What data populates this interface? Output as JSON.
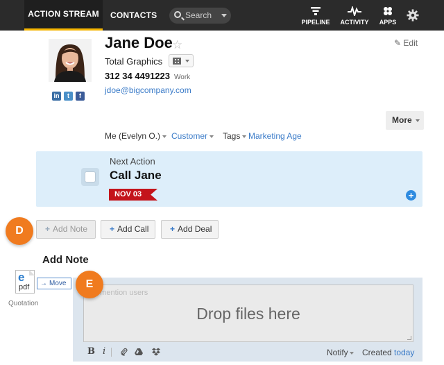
{
  "nav": {
    "active_tab": "ACTION STREAM",
    "contacts_tab": "CONTACTS",
    "search_placeholder": "Search",
    "pipeline": "PIPELINE",
    "activity": "ACTIVITY",
    "apps": "APPS"
  },
  "contact": {
    "name": "Jane Doe",
    "company": "Total Graphics",
    "phone": "312 34 4491223",
    "phone_type": "Work",
    "email": "jdoe@bigcompany.com",
    "edit_label": "Edit",
    "more_label": "More",
    "socials": [
      "in",
      "t",
      "f"
    ]
  },
  "meta": {
    "owner": "Me (Evelyn O.)",
    "type": "Customer",
    "tags_label": "Tags",
    "tag_value": "Marketing Age"
  },
  "next_action": {
    "label": "Next Action",
    "title": "Call Jane",
    "date": "NOV 03"
  },
  "buttons": {
    "add_note": "Add Note",
    "add_call": "Add Call",
    "add_deal": "Add Deal"
  },
  "callouts": {
    "d": "D",
    "e": "E"
  },
  "note": {
    "title": "Add Note",
    "placeholder": "@mention users",
    "drop_text": "Drop files here",
    "notify": "Notify",
    "created_prefix": "Created",
    "created_value": "today"
  },
  "file": {
    "ext": "pdf",
    "name": "Quotation",
    "move_label": "Move"
  },
  "colors": {
    "nav_bg": "#2b2b2b",
    "active_underline": "#f4b400",
    "link": "#3a7bc8",
    "next_action_bg": "#ddeefa",
    "date_flag": "#c4141b",
    "callout": "#f07b1f"
  }
}
